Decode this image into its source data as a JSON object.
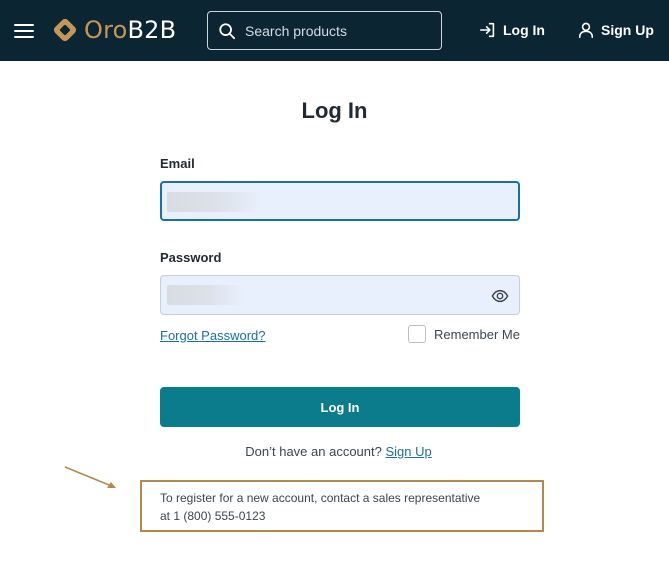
{
  "header": {
    "logo": {
      "part1": "Oro",
      "part2": "B2B"
    },
    "search": {
      "placeholder": "Search products"
    },
    "login_label": "Log In",
    "signup_label": "Sign Up"
  },
  "form": {
    "title": "Log In",
    "email_label": "Email",
    "password_label": "Password",
    "forgot_label": "Forgot Password?",
    "remember_label": "Remember Me",
    "remember_checked": false,
    "submit_label": "Log In",
    "no_account_text": "Don’t have an account?",
    "signup_link": "Sign Up"
  },
  "annotation": {
    "line1": "To register for a new account, contact a sales representative",
    "line2": "at 1 (800) 555-0123"
  },
  "colors": {
    "header_bg": "#0b2533",
    "brand_gold": "#c3975a",
    "primary": "#0b7c8c",
    "link": "#1a6fa6",
    "annotation_border": "#b38a4e"
  },
  "icons": [
    "menu-icon",
    "logo-icon",
    "search-icon",
    "login-icon",
    "user-icon",
    "eye-icon",
    "annotation-arrow"
  ]
}
